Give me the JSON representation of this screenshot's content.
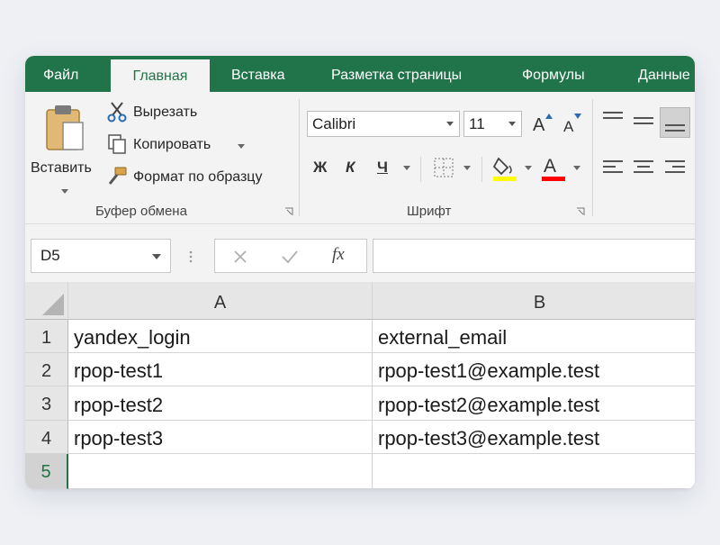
{
  "tabs": [
    {
      "label": "Файл",
      "active": false
    },
    {
      "label": "Главная",
      "active": true
    },
    {
      "label": "Вставка",
      "active": false
    },
    {
      "label": "Разметка страницы",
      "active": false
    },
    {
      "label": "Формулы",
      "active": false
    },
    {
      "label": "Данные",
      "active": false
    }
  ],
  "clipboard": {
    "paste_label": "Вставить",
    "cut_label": "Вырезать",
    "copy_label": "Копировать",
    "format_painter_label": "Формат по образцу",
    "group_label": "Буфер обмена"
  },
  "font": {
    "font_name": "Calibri",
    "font_size": "11",
    "bold_label": "Ж",
    "italic_label": "К",
    "underline_label": "Ч",
    "increase_size_glyph": "A",
    "decrease_size_glyph": "A",
    "font_color_glyph": "A",
    "group_label": "Шрифт",
    "highlight_color": "#ffff00",
    "font_color": "#ff0000"
  },
  "formula_bar": {
    "name_box": "D5",
    "fx_label": "fx",
    "formula": ""
  },
  "sheet": {
    "columns": [
      "A",
      "B"
    ],
    "rows": [
      {
        "num": "1",
        "cells": [
          "yandex_login",
          "external_email"
        ]
      },
      {
        "num": "2",
        "cells": [
          "rpop-test1",
          "rpop-test1@example.test"
        ]
      },
      {
        "num": "3",
        "cells": [
          "rpop-test2",
          "rpop-test2@example.test"
        ]
      },
      {
        "num": "4",
        "cells": [
          "rpop-test3",
          "rpop-test3@example.test"
        ]
      },
      {
        "num": "5",
        "cells": [
          "",
          ""
        ]
      }
    ],
    "selected_row": "5"
  },
  "colors": {
    "accent": "#217346",
    "tabbar": "#21744a"
  }
}
